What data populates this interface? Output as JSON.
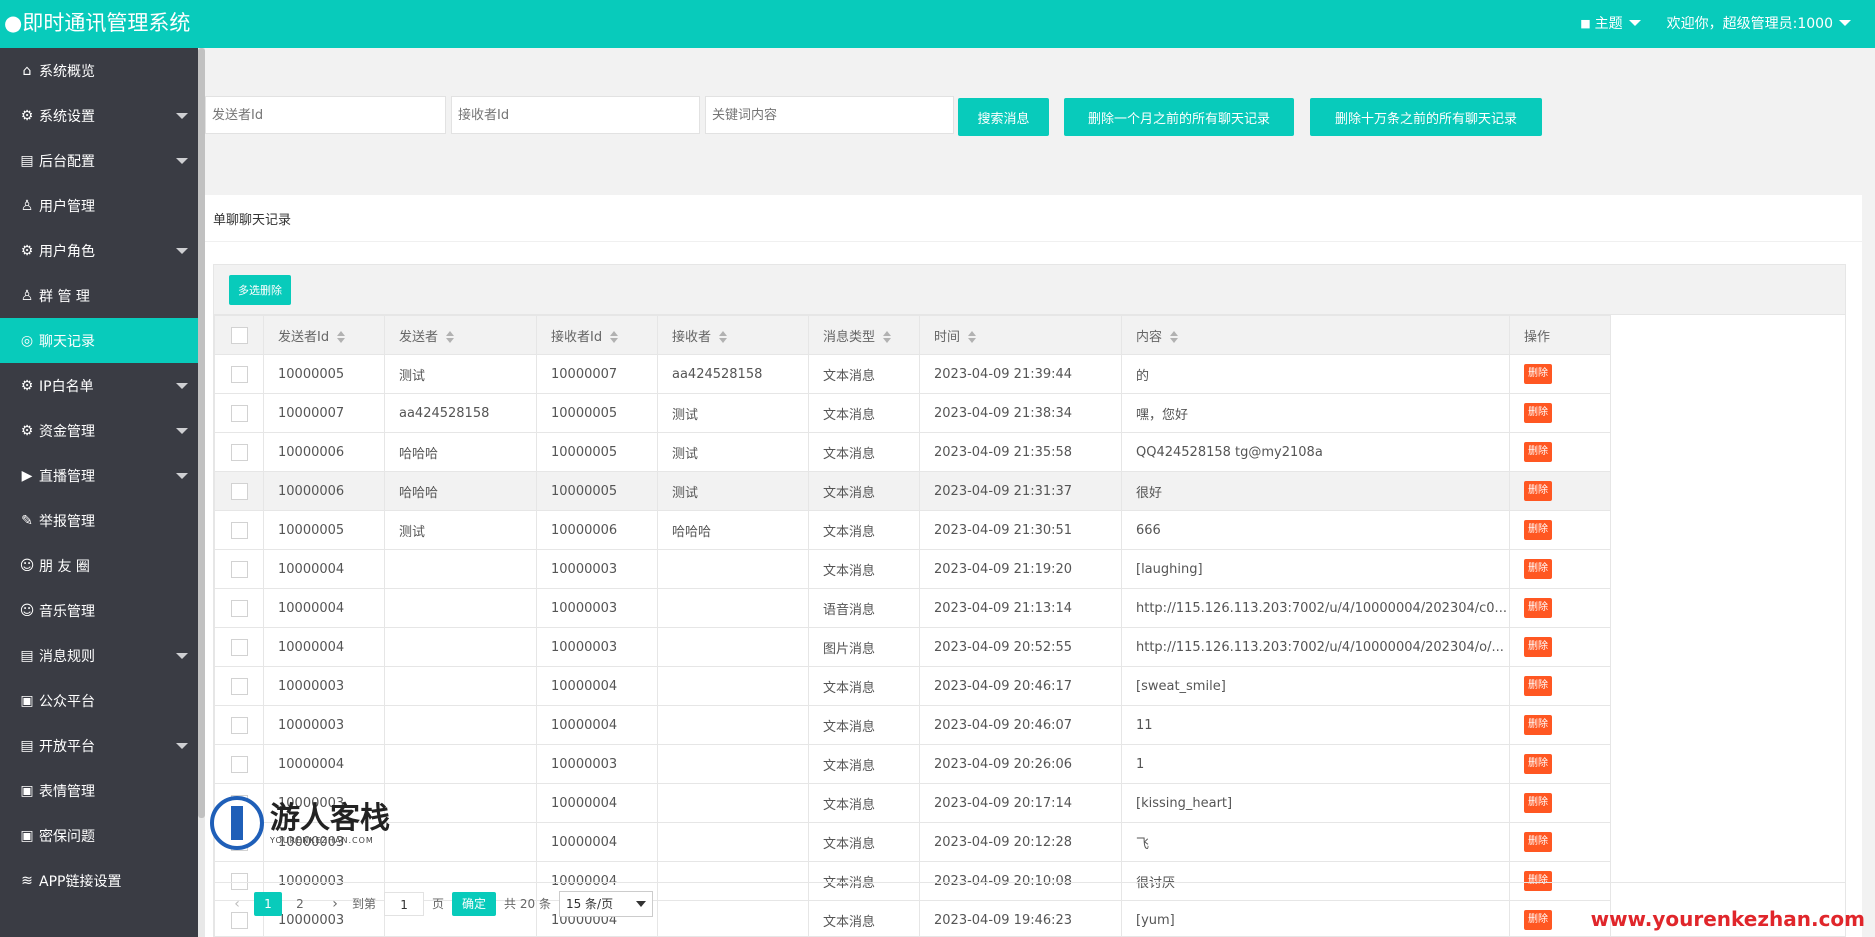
{
  "header": {
    "title": "●即时通讯管理系统",
    "theme_label": "主题",
    "welcome": "欢迎你，超级管理员:1000",
    "brand_color": "#08cbbb"
  },
  "sidebar": {
    "items": [
      {
        "label": "系统概览",
        "icon": "home-icon",
        "glyph": "⌂",
        "has_children": false,
        "active": false
      },
      {
        "label": "系统设置",
        "icon": "gear-icon",
        "glyph": "⚙",
        "has_children": true,
        "active": false
      },
      {
        "label": "后台配置",
        "icon": "panel-icon",
        "glyph": "▤",
        "has_children": true,
        "active": false
      },
      {
        "label": "用户管理",
        "icon": "user-icon",
        "glyph": "♙",
        "has_children": false,
        "active": false
      },
      {
        "label": "用户角色",
        "icon": "gear-icon",
        "glyph": "⚙",
        "has_children": true,
        "active": false
      },
      {
        "label": "群 管 理",
        "icon": "group-icon",
        "glyph": "♙",
        "has_children": false,
        "active": false
      },
      {
        "label": "聊天记录",
        "icon": "chat-icon",
        "glyph": "◎",
        "has_children": false,
        "active": true
      },
      {
        "label": "IP白名单",
        "icon": "gear-icon",
        "glyph": "⚙",
        "has_children": true,
        "active": false
      },
      {
        "label": "资金管理",
        "icon": "gear-icon",
        "glyph": "⚙",
        "has_children": true,
        "active": false
      },
      {
        "label": "直播管理",
        "icon": "video-icon",
        "glyph": "▶",
        "has_children": true,
        "active": false
      },
      {
        "label": "举报管理",
        "icon": "edit-icon",
        "glyph": "✎",
        "has_children": false,
        "active": false
      },
      {
        "label": "朋 友 圈",
        "icon": "smile-icon",
        "glyph": "☺",
        "has_children": false,
        "active": false
      },
      {
        "label": "音乐管理",
        "icon": "smile-icon",
        "glyph": "☺",
        "has_children": false,
        "active": false
      },
      {
        "label": "消息规则",
        "icon": "panel-icon",
        "glyph": "▤",
        "has_children": true,
        "active": false
      },
      {
        "label": "公众平台",
        "icon": "image-icon",
        "glyph": "▣",
        "has_children": false,
        "active": false
      },
      {
        "label": "开放平台",
        "icon": "panel-icon",
        "glyph": "▤",
        "has_children": true,
        "active": false
      },
      {
        "label": "表情管理",
        "icon": "image-icon",
        "glyph": "▣",
        "has_children": false,
        "active": false
      },
      {
        "label": "密保问题",
        "icon": "image-icon",
        "glyph": "▣",
        "has_children": false,
        "active": false
      },
      {
        "label": "APP链接设置",
        "icon": "layers-icon",
        "glyph": "≋",
        "has_children": false,
        "active": false
      }
    ]
  },
  "search": {
    "sender_placeholder": "发送者Id",
    "receiver_placeholder": "接收者Id",
    "keyword_placeholder": "关键词内容",
    "search_label": "搜索消息",
    "delete_month_label": "删除一个月之前的所有聊天记录",
    "delete_100k_label": "删除十万条之前的所有聊天记录"
  },
  "panel": {
    "title": "单聊聊天记录",
    "batch_delete_label": "多选删除"
  },
  "table": {
    "columns": [
      "发送者Id",
      "发送者",
      "接收者Id",
      "接收者",
      "消息类型",
      "时间",
      "内容",
      "操作"
    ],
    "delete_label": "删除",
    "rows": [
      {
        "sender_id": "10000005",
        "sender": "测试",
        "receiver_id": "10000007",
        "receiver": "aa424528158",
        "type": "文本消息",
        "time": "2023-04-09 21:39:44",
        "content": "的"
      },
      {
        "sender_id": "10000007",
        "sender": "aa424528158",
        "receiver_id": "10000005",
        "receiver": "测试",
        "type": "文本消息",
        "time": "2023-04-09 21:38:34",
        "content": "嘿，您好"
      },
      {
        "sender_id": "10000006",
        "sender": "哈哈哈",
        "receiver_id": "10000005",
        "receiver": "测试",
        "type": "文本消息",
        "time": "2023-04-09 21:35:58",
        "content": "QQ424528158 tg@my2108a"
      },
      {
        "sender_id": "10000006",
        "sender": "哈哈哈",
        "receiver_id": "10000005",
        "receiver": "测试",
        "type": "文本消息",
        "time": "2023-04-09 21:31:37",
        "content": "很好"
      },
      {
        "sender_id": "10000005",
        "sender": "测试",
        "receiver_id": "10000006",
        "receiver": "哈哈哈",
        "type": "文本消息",
        "time": "2023-04-09 21:30:51",
        "content": "666"
      },
      {
        "sender_id": "10000004",
        "sender": "",
        "receiver_id": "10000003",
        "receiver": "",
        "type": "文本消息",
        "time": "2023-04-09 21:19:20",
        "content": "[laughing]"
      },
      {
        "sender_id": "10000004",
        "sender": "",
        "receiver_id": "10000003",
        "receiver": "",
        "type": "语音消息",
        "time": "2023-04-09 21:13:14",
        "content": "http://115.126.113.203:7002/u/4/10000004/202304/c0..."
      },
      {
        "sender_id": "10000004",
        "sender": "",
        "receiver_id": "10000003",
        "receiver": "",
        "type": "图片消息",
        "time": "2023-04-09 20:52:55",
        "content": "http://115.126.113.203:7002/u/4/10000004/202304/o/..."
      },
      {
        "sender_id": "10000003",
        "sender": "",
        "receiver_id": "10000004",
        "receiver": "",
        "type": "文本消息",
        "time": "2023-04-09 20:46:17",
        "content": "[sweat_smile]"
      },
      {
        "sender_id": "10000003",
        "sender": "",
        "receiver_id": "10000004",
        "receiver": "",
        "type": "文本消息",
        "time": "2023-04-09 20:46:07",
        "content": "11"
      },
      {
        "sender_id": "10000004",
        "sender": "",
        "receiver_id": "10000003",
        "receiver": "",
        "type": "文本消息",
        "time": "2023-04-09 20:26:06",
        "content": "1"
      },
      {
        "sender_id": "10000003",
        "sender": "",
        "receiver_id": "10000004",
        "receiver": "",
        "type": "文本消息",
        "time": "2023-04-09 20:17:14",
        "content": "[kissing_heart]"
      },
      {
        "sender_id": "10000003",
        "sender": "",
        "receiver_id": "10000004",
        "receiver": "",
        "type": "文本消息",
        "time": "2023-04-09 20:12:28",
        "content": "飞"
      },
      {
        "sender_id": "10000003",
        "sender": "",
        "receiver_id": "10000004",
        "receiver": "",
        "type": "文本消息",
        "time": "2023-04-09 20:10:08",
        "content": "很讨厌"
      },
      {
        "sender_id": "10000003",
        "sender": "",
        "receiver_id": "10000004",
        "receiver": "",
        "type": "文本消息",
        "time": "2023-04-09 19:46:23",
        "content": "[yum]"
      }
    ]
  },
  "pagination": {
    "pages": [
      "1",
      "2"
    ],
    "current": "1",
    "goto_label": "到第",
    "goto_value": "1",
    "page_unit": "页",
    "confirm_label": "确定",
    "total": "共 20 条",
    "page_size": "15 条/页"
  },
  "watermark": {
    "name": "游人客栈",
    "domain_small": "YOURENKEZHAN.COM",
    "url": "www.yourenkezhan.com"
  }
}
